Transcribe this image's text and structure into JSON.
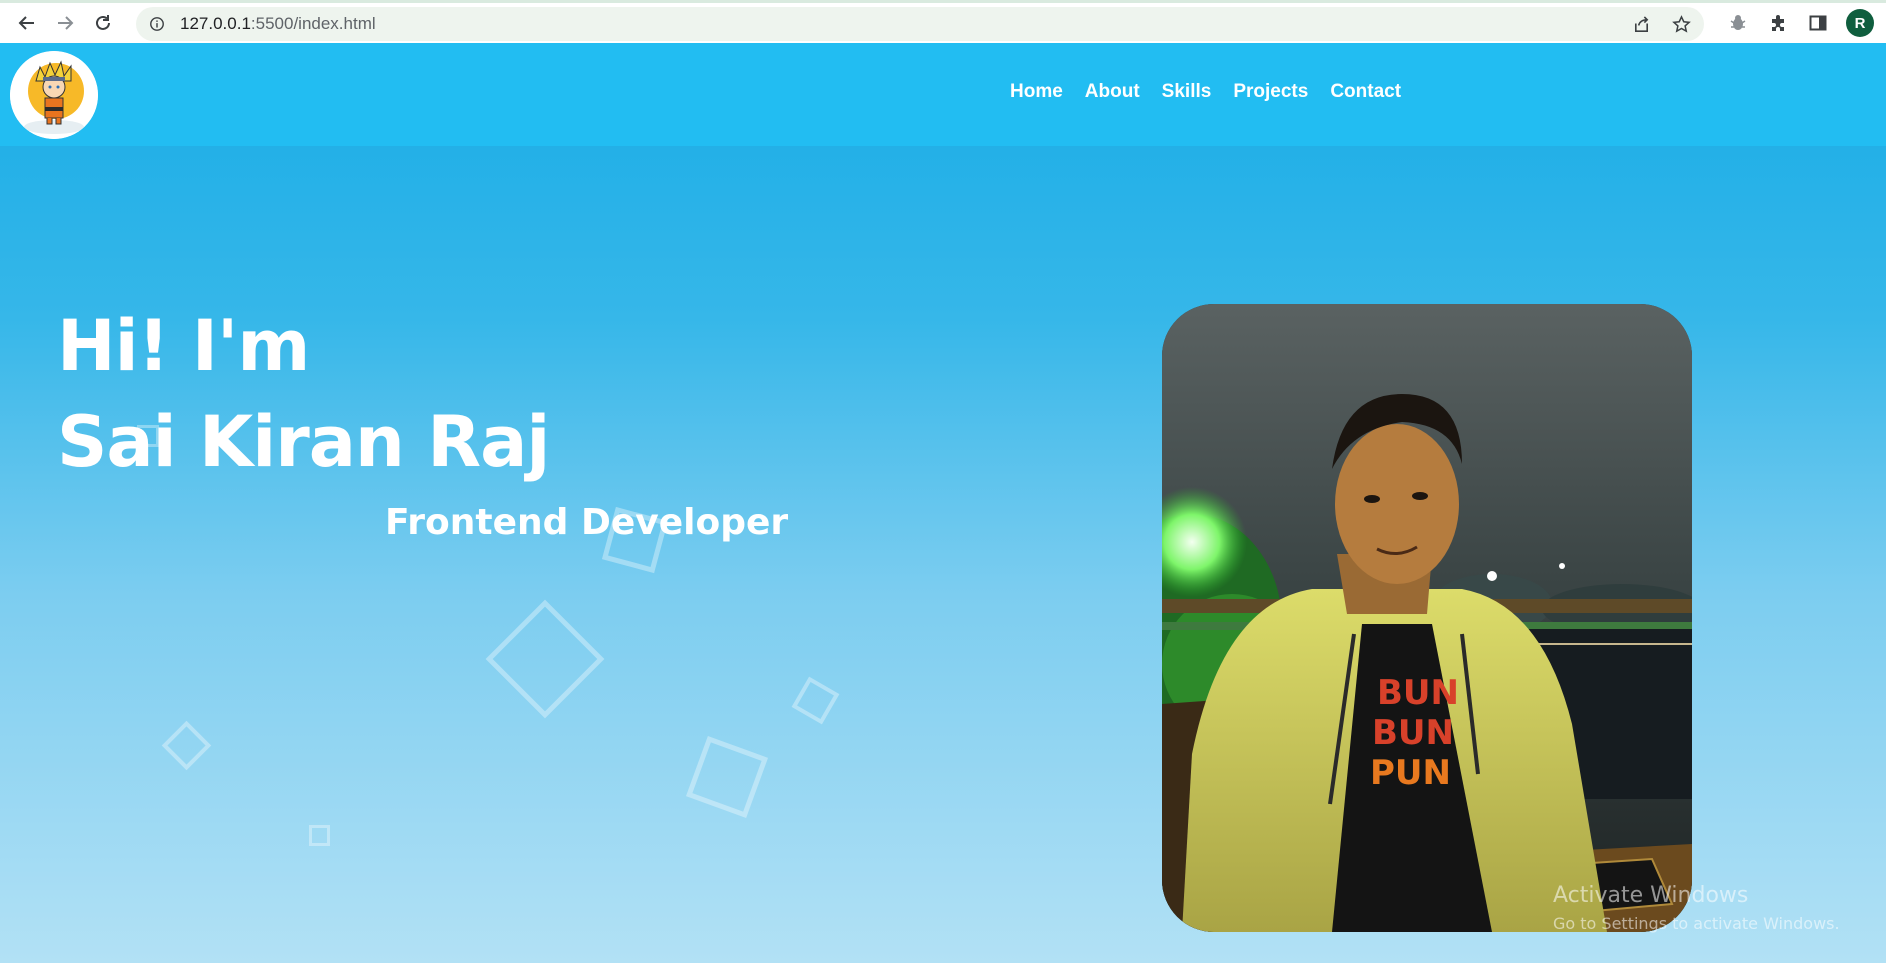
{
  "browser": {
    "url_host": "127.0.0.1",
    "url_path": ":5500/index.html",
    "profile_initial": "R",
    "icons": [
      "back-icon",
      "forward-icon",
      "reload-icon",
      "site-info-icon",
      "share-icon",
      "bookmark-star-icon",
      "extension-bug-icon",
      "extensions-puzzle-icon",
      "side-panel-icon"
    ]
  },
  "nav": {
    "items": [
      {
        "label": "Home"
      },
      {
        "label": "About"
      },
      {
        "label": "Skills"
      },
      {
        "label": "Projects"
      },
      {
        "label": "Contact"
      }
    ]
  },
  "hero": {
    "greeting": "Hi! I'm",
    "name": "Sai Kiran Raj",
    "role": "Frontend Developer"
  },
  "watermark": {
    "title": "Activate Windows",
    "subtitle": "Go to Settings to activate Windows."
  },
  "colors": {
    "header": "#22bdf2",
    "accent": "#18ace6"
  }
}
